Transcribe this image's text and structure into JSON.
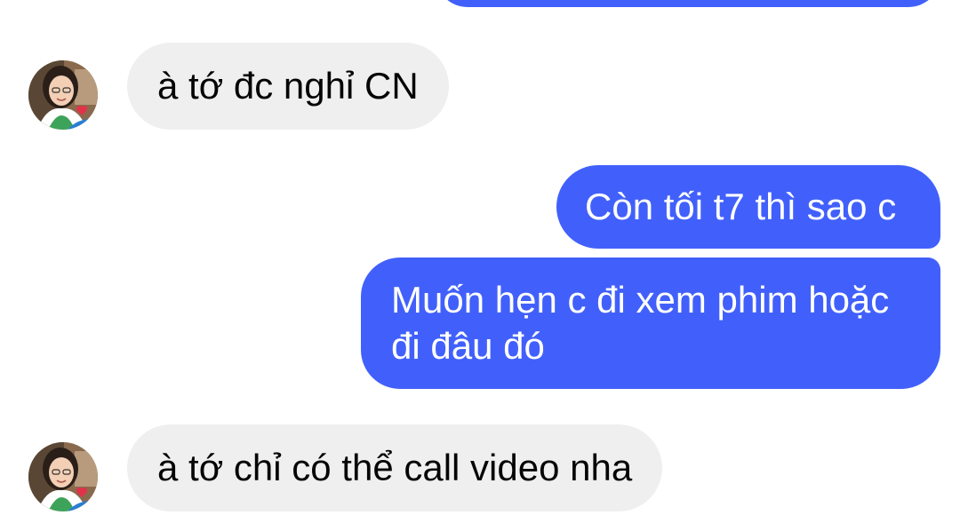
{
  "conversation": {
    "messages": [
      {
        "id": "m1",
        "direction": "received",
        "text": "à tớ đc nghỉ CN"
      },
      {
        "id": "m2",
        "direction": "sent",
        "text": "Còn tối t7 thì sao c"
      },
      {
        "id": "m3",
        "direction": "sent",
        "lines": [
          "Muốn hẹn c đi xem phim hoặc",
          "đi đâu đó"
        ]
      },
      {
        "id": "m4",
        "direction": "received",
        "text": "à tớ chỉ có thể call video nha"
      }
    ],
    "contact_avatar_icon": "profile-photo-avatar",
    "colors": {
      "sent_bubble": "#4160fb",
      "received_bubble": "#efeff0",
      "sent_text": "#ffffff",
      "received_text": "#050505"
    }
  }
}
